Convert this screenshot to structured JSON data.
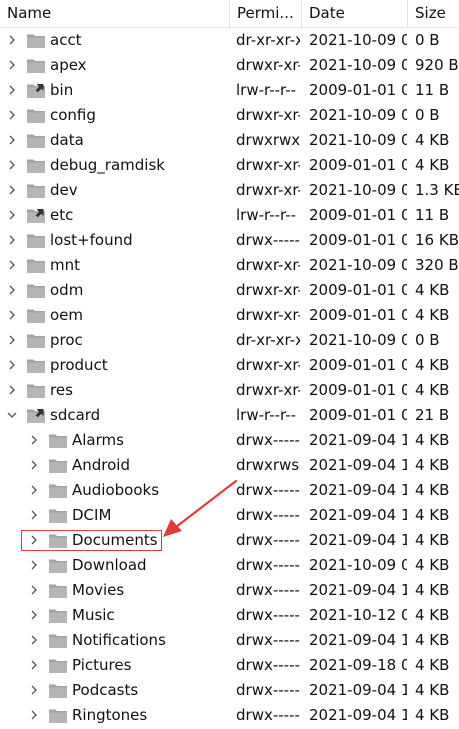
{
  "columns": {
    "name": "Name",
    "permissions": "Permi...",
    "date": "Date",
    "size": "Size"
  },
  "colors": {
    "folder": "#a3a3a3",
    "highlight": "#e23b3b",
    "text": "#111111"
  },
  "rows": [
    {
      "name": "acct",
      "perm": "dr-xr-xr-x",
      "date": "2021-10-09 0",
      "size": "0 B",
      "level": 0,
      "expanded": false,
      "link": false
    },
    {
      "name": "apex",
      "perm": "drwxr-xr-x",
      "date": "2021-10-09 0",
      "size": "920 B",
      "level": 0,
      "expanded": false,
      "link": false
    },
    {
      "name": "bin",
      "perm": "lrw-r--r--",
      "date": "2009-01-01 0",
      "size": "11 B",
      "level": 0,
      "expanded": false,
      "link": true
    },
    {
      "name": "config",
      "perm": "drwxr-xr-x",
      "date": "2021-10-09 0",
      "size": "0 B",
      "level": 0,
      "expanded": false,
      "link": false
    },
    {
      "name": "data",
      "perm": "drwxrwx--x",
      "date": "2021-10-09 0",
      "size": "4 KB",
      "level": 0,
      "expanded": false,
      "link": false
    },
    {
      "name": "debug_ramdisk",
      "perm": "drwxr-xr-x",
      "date": "2009-01-01 0",
      "size": "4 KB",
      "level": 0,
      "expanded": false,
      "link": false
    },
    {
      "name": "dev",
      "perm": "drwxr-xr-x",
      "date": "2021-10-09 0",
      "size": "1.3 KB",
      "level": 0,
      "expanded": false,
      "link": false
    },
    {
      "name": "etc",
      "perm": "lrw-r--r--",
      "date": "2009-01-01 0",
      "size": "11 B",
      "level": 0,
      "expanded": false,
      "link": true
    },
    {
      "name": "lost+found",
      "perm": "drwx------",
      "date": "2009-01-01 0",
      "size": "16 KB",
      "level": 0,
      "expanded": false,
      "link": false
    },
    {
      "name": "mnt",
      "perm": "drwxr-xr-x",
      "date": "2021-10-09 0",
      "size": "320 B",
      "level": 0,
      "expanded": false,
      "link": false
    },
    {
      "name": "odm",
      "perm": "drwxr-xr-x",
      "date": "2009-01-01 0",
      "size": "4 KB",
      "level": 0,
      "expanded": false,
      "link": false
    },
    {
      "name": "oem",
      "perm": "drwxr-xr-x",
      "date": "2009-01-01 0",
      "size": "4 KB",
      "level": 0,
      "expanded": false,
      "link": false
    },
    {
      "name": "proc",
      "perm": "dr-xr-xr-x",
      "date": "2021-10-09 0",
      "size": "0 B",
      "level": 0,
      "expanded": false,
      "link": false
    },
    {
      "name": "product",
      "perm": "drwxr-xr-x",
      "date": "2009-01-01 0",
      "size": "4 KB",
      "level": 0,
      "expanded": false,
      "link": false
    },
    {
      "name": "res",
      "perm": "drwxr-xr-x",
      "date": "2009-01-01 0",
      "size": "4 KB",
      "level": 0,
      "expanded": false,
      "link": false
    },
    {
      "name": "sdcard",
      "perm": "lrw-r--r--",
      "date": "2009-01-01 0",
      "size": "21 B",
      "level": 0,
      "expanded": true,
      "link": true
    },
    {
      "name": "Alarms",
      "perm": "drwx------",
      "date": "2021-09-04 1",
      "size": "4 KB",
      "level": 1,
      "expanded": false,
      "link": false
    },
    {
      "name": "Android",
      "perm": "drwxrws---",
      "date": "2021-09-04 1",
      "size": "4 KB",
      "level": 1,
      "expanded": false,
      "link": false
    },
    {
      "name": "Audiobooks",
      "perm": "drwx------",
      "date": "2021-09-04 1",
      "size": "4 KB",
      "level": 1,
      "expanded": false,
      "link": false
    },
    {
      "name": "DCIM",
      "perm": "drwx------",
      "date": "2021-09-04 1",
      "size": "4 KB",
      "level": 1,
      "expanded": false,
      "link": false
    },
    {
      "name": "Documents",
      "perm": "drwx------",
      "date": "2021-09-04 1",
      "size": "4 KB",
      "level": 1,
      "expanded": false,
      "link": false
    },
    {
      "name": "Download",
      "perm": "drwx------",
      "date": "2021-10-09 0",
      "size": "4 KB",
      "level": 1,
      "expanded": false,
      "link": false
    },
    {
      "name": "Movies",
      "perm": "drwx------",
      "date": "2021-09-04 1",
      "size": "4 KB",
      "level": 1,
      "expanded": false,
      "link": false
    },
    {
      "name": "Music",
      "perm": "drwx------",
      "date": "2021-10-12 0",
      "size": "4 KB",
      "level": 1,
      "expanded": false,
      "link": false
    },
    {
      "name": "Notifications",
      "perm": "drwx------",
      "date": "2021-09-04 1",
      "size": "4 KB",
      "level": 1,
      "expanded": false,
      "link": false
    },
    {
      "name": "Pictures",
      "perm": "drwx------",
      "date": "2021-09-18 0",
      "size": "4 KB",
      "level": 1,
      "expanded": false,
      "link": false
    },
    {
      "name": "Podcasts",
      "perm": "drwx------",
      "date": "2021-09-04 1",
      "size": "4 KB",
      "level": 1,
      "expanded": false,
      "link": false
    },
    {
      "name": "Ringtones",
      "perm": "drwx------",
      "date": "2021-09-04 1",
      "size": "4 KB",
      "level": 1,
      "expanded": false,
      "link": false
    }
  ]
}
